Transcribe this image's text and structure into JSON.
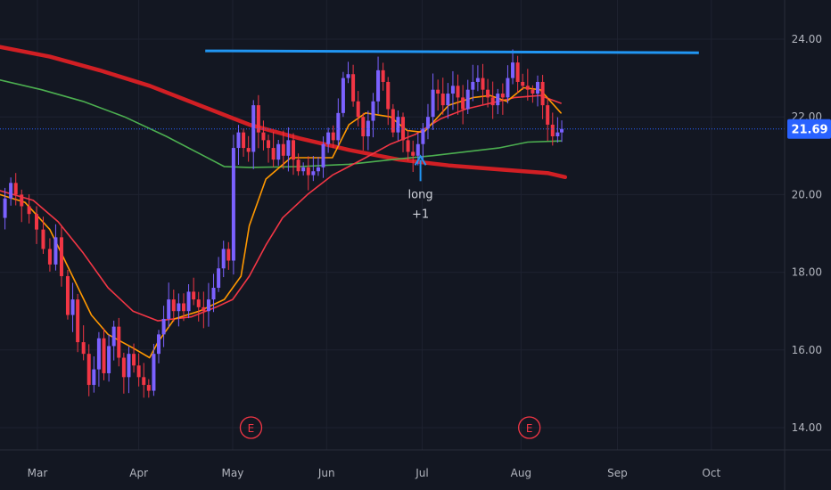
{
  "chart_data": {
    "type": "candlestick",
    "ylim": [
      13.5,
      24.8
    ],
    "grid": true,
    "x_axis": {
      "months": [
        {
          "label": "Mar",
          "t": 0.045
        },
        {
          "label": "Apr",
          "t": 0.167
        },
        {
          "label": "May",
          "t": 0.28
        },
        {
          "label": "Jun",
          "t": 0.393
        },
        {
          "label": "Jul",
          "t": 0.508
        },
        {
          "label": "Aug",
          "t": 0.627
        },
        {
          "label": "Sep",
          "t": 0.743
        },
        {
          "label": "Oct",
          "t": 0.856
        }
      ]
    },
    "y_axis": {
      "ticks": [
        "24.00",
        "22.00",
        "20.00",
        "18.00",
        "16.00",
        "14.00"
      ],
      "tick_values": [
        24,
        22,
        20,
        18,
        16,
        14
      ]
    },
    "last_price": {
      "label": "21.69",
      "value": 21.69,
      "color": "#2962ff"
    },
    "annotations": [
      {
        "type": "arrow",
        "text_lines": [
          "long",
          "+1"
        ],
        "t": 0.506,
        "y": 20.85
      }
    ],
    "earnings": [
      {
        "label": "E",
        "t": 0.302
      },
      {
        "label": "E",
        "t": 0.637
      }
    ],
    "resistance_line": {
      "t_start": 0.247,
      "t_end": 0.841,
      "y_start": 23.7,
      "y_end": 23.65,
      "color": "#2196f3"
    },
    "series": [
      {
        "kind": "ma",
        "color": "#d11f24",
        "points": [
          [
            0,
            23.8
          ],
          [
            0.06,
            23.55
          ],
          [
            0.12,
            23.2
          ],
          [
            0.18,
            22.8
          ],
          [
            0.24,
            22.3
          ],
          [
            0.3,
            21.8
          ],
          [
            0.36,
            21.45
          ],
          [
            0.42,
            21.15
          ],
          [
            0.48,
            20.9
          ],
          [
            0.54,
            20.75
          ],
          [
            0.6,
            20.65
          ],
          [
            0.66,
            20.55
          ],
          [
            0.68,
            20.45
          ]
        ]
      },
      {
        "kind": "ma",
        "color": "#4caf50",
        "points": [
          [
            0,
            22.95
          ],
          [
            0.05,
            22.7
          ],
          [
            0.1,
            22.4
          ],
          [
            0.15,
            22.0
          ],
          [
            0.2,
            21.5
          ],
          [
            0.245,
            21.0
          ],
          [
            0.27,
            20.72
          ],
          [
            0.3,
            20.7
          ],
          [
            0.36,
            20.72
          ],
          [
            0.42,
            20.78
          ],
          [
            0.48,
            20.92
          ],
          [
            0.52,
            21.0
          ],
          [
            0.56,
            21.1
          ],
          [
            0.6,
            21.2
          ],
          [
            0.635,
            21.35
          ],
          [
            0.675,
            21.38
          ]
        ]
      },
      {
        "kind": "ma",
        "color": "#f23645",
        "points": [
          [
            0,
            20.1
          ],
          [
            0.04,
            19.85
          ],
          [
            0.07,
            19.3
          ],
          [
            0.1,
            18.5
          ],
          [
            0.13,
            17.6
          ],
          [
            0.16,
            17.0
          ],
          [
            0.19,
            16.75
          ],
          [
            0.23,
            16.85
          ],
          [
            0.26,
            17.1
          ],
          [
            0.28,
            17.3
          ],
          [
            0.3,
            17.9
          ],
          [
            0.32,
            18.7
          ],
          [
            0.34,
            19.4
          ],
          [
            0.37,
            20.0
          ],
          [
            0.4,
            20.5
          ],
          [
            0.44,
            20.95
          ],
          [
            0.47,
            21.3
          ],
          [
            0.5,
            21.55
          ],
          [
            0.53,
            21.95
          ],
          [
            0.56,
            22.2
          ],
          [
            0.59,
            22.35
          ],
          [
            0.62,
            22.5
          ],
          [
            0.65,
            22.55
          ],
          [
            0.675,
            22.35
          ]
        ]
      },
      {
        "kind": "ma",
        "color": "#ff9800",
        "points": [
          [
            0,
            20.0
          ],
          [
            0.03,
            19.8
          ],
          [
            0.06,
            19.1
          ],
          [
            0.085,
            18.0
          ],
          [
            0.11,
            16.9
          ],
          [
            0.13,
            16.4
          ],
          [
            0.16,
            16.05
          ],
          [
            0.18,
            15.8
          ],
          [
            0.19,
            16.2
          ],
          [
            0.21,
            16.8
          ],
          [
            0.24,
            17.0
          ],
          [
            0.27,
            17.3
          ],
          [
            0.29,
            17.9
          ],
          [
            0.3,
            19.2
          ],
          [
            0.32,
            20.4
          ],
          [
            0.35,
            20.95
          ],
          [
            0.38,
            20.95
          ],
          [
            0.4,
            20.95
          ],
          [
            0.42,
            21.8
          ],
          [
            0.44,
            22.1
          ],
          [
            0.47,
            22.0
          ],
          [
            0.49,
            21.65
          ],
          [
            0.51,
            21.6
          ],
          [
            0.54,
            22.3
          ],
          [
            0.57,
            22.5
          ],
          [
            0.59,
            22.55
          ],
          [
            0.61,
            22.4
          ],
          [
            0.63,
            22.75
          ],
          [
            0.65,
            22.7
          ],
          [
            0.675,
            22.1
          ]
        ]
      }
    ],
    "candle_path": [
      [
        0.002,
        19.4
      ],
      [
        0.01,
        19.9
      ],
      [
        0.016,
        20.3
      ],
      [
        0.022,
        20.0
      ],
      [
        0.03,
        19.7
      ],
      [
        0.04,
        19.5
      ],
      [
        0.048,
        19.1
      ],
      [
        0.056,
        18.6
      ],
      [
        0.064,
        18.2
      ],
      [
        0.07,
        18.9
      ],
      [
        0.078,
        17.9
      ],
      [
        0.085,
        16.9
      ],
      [
        0.09,
        17.3
      ],
      [
        0.097,
        16.2
      ],
      [
        0.104,
        15.9
      ],
      [
        0.11,
        15.1
      ],
      [
        0.116,
        15.5
      ],
      [
        0.122,
        16.3
      ],
      [
        0.128,
        15.4
      ],
      [
        0.134,
        16.1
      ],
      [
        0.14,
        16.6
      ],
      [
        0.146,
        15.8
      ],
      [
        0.152,
        15.3
      ],
      [
        0.158,
        15.9
      ],
      [
        0.164,
        15.6
      ],
      [
        0.17,
        15.3
      ],
      [
        0.176,
        15.1
      ],
      [
        0.182,
        14.95
      ],
      [
        0.188,
        15.9
      ],
      [
        0.194,
        16.4
      ],
      [
        0.2,
        16.8
      ],
      [
        0.206,
        17.3
      ],
      [
        0.212,
        17.0
      ],
      [
        0.218,
        17.2
      ],
      [
        0.224,
        17.0
      ],
      [
        0.23,
        17.5
      ],
      [
        0.236,
        17.3
      ],
      [
        0.242,
        17.1
      ],
      [
        0.248,
        17.0
      ],
      [
        0.254,
        17.3
      ],
      [
        0.26,
        17.6
      ],
      [
        0.266,
        18.1
      ],
      [
        0.272,
        18.6
      ],
      [
        0.278,
        18.3
      ],
      [
        0.284,
        21.2
      ],
      [
        0.29,
        21.6
      ],
      [
        0.296,
        21.2
      ],
      [
        0.302,
        21.1
      ],
      [
        0.308,
        22.3
      ],
      [
        0.314,
        21.6
      ],
      [
        0.32,
        21.4
      ],
      [
        0.326,
        21.2
      ],
      [
        0.332,
        20.9
      ],
      [
        0.338,
        21.3
      ],
      [
        0.344,
        21.0
      ],
      [
        0.35,
        21.4
      ],
      [
        0.356,
        20.9
      ],
      [
        0.362,
        20.6
      ],
      [
        0.368,
        20.7
      ],
      [
        0.374,
        20.5
      ],
      [
        0.38,
        20.6
      ],
      [
        0.386,
        20.7
      ],
      [
        0.392,
        21.3
      ],
      [
        0.398,
        21.6
      ],
      [
        0.404,
        21.4
      ],
      [
        0.41,
        22.1
      ],
      [
        0.416,
        23.0
      ],
      [
        0.422,
        23.1
      ],
      [
        0.428,
        22.4
      ],
      [
        0.434,
        22.0
      ],
      [
        0.44,
        21.5
      ],
      [
        0.446,
        21.9
      ],
      [
        0.452,
        22.4
      ],
      [
        0.458,
        23.2
      ],
      [
        0.464,
        22.9
      ],
      [
        0.47,
        22.2
      ],
      [
        0.476,
        21.6
      ],
      [
        0.482,
        22.0
      ],
      [
        0.488,
        21.4
      ],
      [
        0.494,
        21.1
      ],
      [
        0.5,
        21.0
      ],
      [
        0.506,
        21.3
      ],
      [
        0.512,
        21.7
      ],
      [
        0.518,
        22.0
      ],
      [
        0.524,
        22.7
      ],
      [
        0.53,
        22.6
      ],
      [
        0.536,
        22.3
      ],
      [
        0.542,
        22.6
      ],
      [
        0.548,
        22.8
      ],
      [
        0.554,
        22.5
      ],
      [
        0.56,
        22.2
      ],
      [
        0.566,
        22.7
      ],
      [
        0.572,
        22.9
      ],
      [
        0.578,
        23.0
      ],
      [
        0.584,
        22.7
      ],
      [
        0.59,
        22.5
      ],
      [
        0.596,
        22.3
      ],
      [
        0.602,
        22.6
      ],
      [
        0.608,
        22.5
      ],
      [
        0.614,
        23.0
      ],
      [
        0.62,
        23.4
      ],
      [
        0.626,
        22.9
      ],
      [
        0.632,
        22.8
      ],
      [
        0.638,
        22.7
      ],
      [
        0.644,
        22.6
      ],
      [
        0.65,
        22.9
      ],
      [
        0.656,
        22.3
      ],
      [
        0.662,
        21.8
      ],
      [
        0.668,
        21.5
      ],
      [
        0.674,
        21.6
      ],
      [
        0.678,
        21.69
      ]
    ],
    "colors": {
      "up_candle": "#7b61ff",
      "down_candle": "#f23645",
      "background": "#131722",
      "grid": "#1e2230",
      "axis_text": "#b2b5be"
    }
  }
}
